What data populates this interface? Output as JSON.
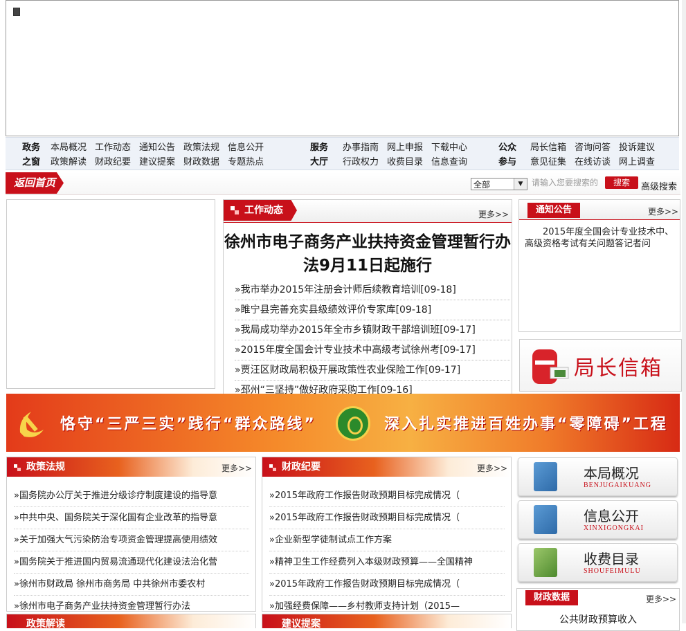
{
  "nav": {
    "groups": [
      {
        "head": [
          "政务",
          "之窗"
        ],
        "row1": [
          "本局概况",
          "工作动态",
          "通知公告",
          "政策法规",
          "信息公开"
        ],
        "row2": [
          "政策解读",
          "财政纪要",
          "建议提案",
          "财政数据",
          "专题热点"
        ]
      },
      {
        "head": [
          "服务",
          "大厅"
        ],
        "row1": [
          "办事指南",
          "网上申报",
          "下载中心"
        ],
        "row2": [
          "行政权力",
          "收费目录",
          "信息查询"
        ]
      },
      {
        "head": [
          "公众",
          "参与"
        ],
        "row1": [
          "局长信箱",
          "咨询问答",
          "投诉建议"
        ],
        "row2": [
          "意见征集",
          "在线访谈",
          "网上调查"
        ]
      }
    ]
  },
  "homebar": {
    "home_label": "返回首页",
    "scope_value": "全部",
    "search_placeholder": "请输入您要搜索的",
    "search_button": "搜索",
    "advanced": "高级搜索"
  },
  "news": {
    "tab": "工作动态",
    "more": "更多>>",
    "headline": "徐州市电子商务产业扶持资金管理暂行办法9月11日起施行",
    "items": [
      "»我市举办2015年注册会计师后续教育培训[09-18]",
      "»睢宁县完善充实县级绩效评价专家库[09-18]",
      "»我局成功举办2015年全市乡镇财政干部培训班[09-17]",
      "»2015年度全国会计专业技术中高级考试徐州考[09-17]",
      "»贾汪区财政局积极开展政策性农业保险工作[09-17]",
      "»邳州“三坚持”做好政府采购工作[09-16]"
    ]
  },
  "notice": {
    "tab": "通知公告",
    "more": "更多>>",
    "text": "2015年度全国会计专业技术中、高级资格考试有关问题答记者问"
  },
  "mailbox": {
    "label": "局长信箱"
  },
  "slogan": {
    "left": "恪守“三严三实”践行“群众路线”",
    "right": "深入扎实推进百姓办事“零障碍”工程"
  },
  "policy": {
    "tab": "政策法规",
    "more": "更多>>",
    "items": [
      "»国务院办公厅关于推进分级诊疗制度建设的指导意",
      "»中共中央、国务院关于深化国有企业改革的指导意",
      "»关于加强大气污染防治专项资金管理提高使用绩效",
      "»国务院关于推进国内贸易流通现代化建设法治化营",
      "»徐州市财政局 徐州市商务局 中共徐州市委农村",
      "»徐州市电子商务产业扶持资金管理暂行办法"
    ],
    "next_tab": "政策解读"
  },
  "finance": {
    "tab": "财政纪要",
    "more": "更多>>",
    "items": [
      "»2015年政府工作报告财政预期目标完成情况（",
      "»2015年政府工作报告财政预期目标完成情况（",
      "»企业新型学徒制试点工作方案",
      "»精神卫生工作经费列入本级财政预算——全国精神",
      "»2015年政府工作报告财政预期目标完成情况（",
      "»加强经费保障——乡村教师支持计划（2015—"
    ],
    "next_tab": "建议提案"
  },
  "cards": [
    {
      "title": "本局概况",
      "sub": "BENJUGAIKUANG"
    },
    {
      "title": "信息公开",
      "sub": "XINXIGONGKAI"
    },
    {
      "title": "收费目录",
      "sub": "SHOUFEIMULU"
    }
  ],
  "findata": {
    "tab": "财政数据",
    "more": "更多>>",
    "text": "公共财政预算收入"
  }
}
